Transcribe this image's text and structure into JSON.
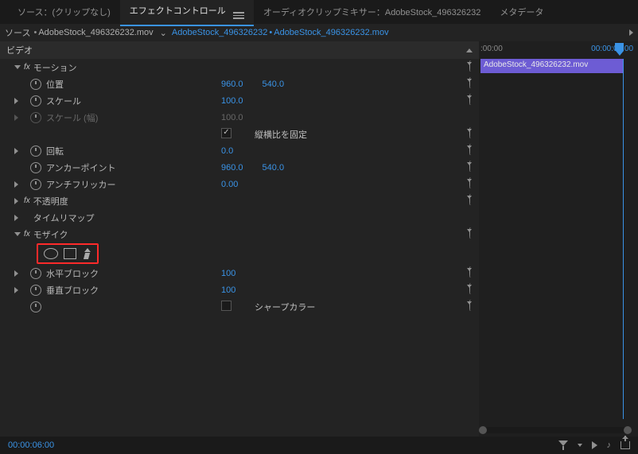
{
  "tabs": {
    "source": "ソース：(クリップなし)",
    "effect_controls": "エフェクトコントロール",
    "audio_mixer": "オーディオクリップミキサー：AdobeStock_496326232",
    "metadata": "メタデータ"
  },
  "header": {
    "source_prefix": "ソース",
    "source_clip": "AdobeStock_496326232.mov",
    "seq_name": "AdobeStock_496326232",
    "seq_clip": "AdobeStock_496326232.mov"
  },
  "video_section": "ビデオ",
  "motion": {
    "label": "モーション",
    "position": {
      "label": "位置",
      "x": "960.0",
      "y": "540.0"
    },
    "scale": {
      "label": "スケール",
      "v": "100.0"
    },
    "scale_w": {
      "label": "スケール (幅)",
      "v": "100.0"
    },
    "uniform": {
      "label": "縦横比を固定"
    },
    "rotation": {
      "label": "回転",
      "v": "0.0"
    },
    "anchor": {
      "label": "アンカーポイント",
      "x": "960.0",
      "y": "540.0"
    },
    "antiflicker": {
      "label": "アンチフリッカー",
      "v": "0.00"
    }
  },
  "opacity": {
    "label": "不透明度"
  },
  "timeremap": {
    "label": "タイムリマップ"
  },
  "mosaic": {
    "label": "モザイク",
    "hblocks": {
      "label": "水平ブロック",
      "v": "100"
    },
    "vblocks": {
      "label": "垂直ブロック",
      "v": "100"
    },
    "sharp": {
      "label": "シャープカラー"
    }
  },
  "timeline": {
    "tick1": ":00:00",
    "tick2": "00:00:05:00",
    "clip": "AdobeStock_496326232.mov"
  },
  "timecode": "00:00:06:00"
}
